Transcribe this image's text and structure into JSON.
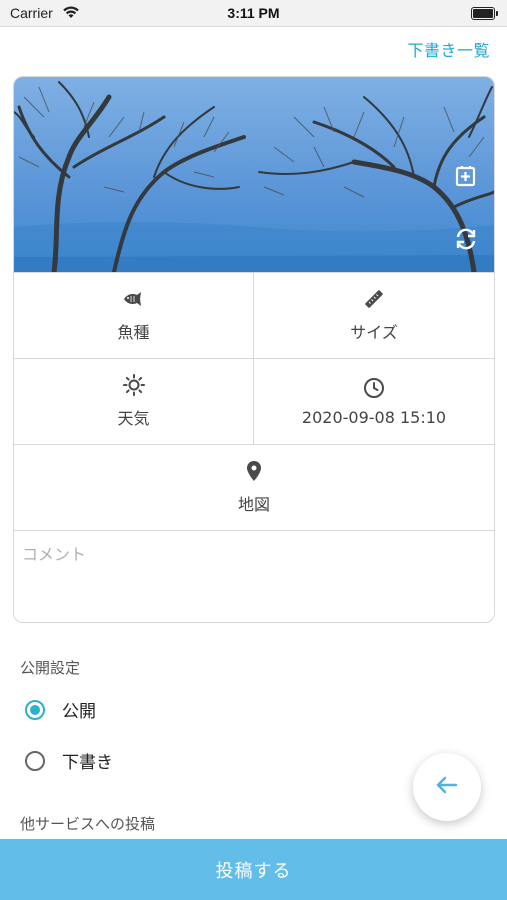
{
  "status_bar": {
    "carrier": "Carrier",
    "time": "3:11 PM"
  },
  "header": {
    "drafts_link": "下書き一覧"
  },
  "photo": {
    "icons": [
      "add-photo-icon",
      "rotate-icon"
    ]
  },
  "fields": {
    "fish": {
      "label": "魚種",
      "icon": "fish-icon"
    },
    "size": {
      "label": "サイズ",
      "icon": "ruler-icon"
    },
    "weather": {
      "label": "天気",
      "icon": "sun-icon"
    },
    "datetime": {
      "label": "2020-09-08 15:10",
      "icon": "clock-icon"
    },
    "map": {
      "label": "地図",
      "icon": "map-pin-icon"
    }
  },
  "comment": {
    "placeholder": "コメント",
    "value": ""
  },
  "visibility": {
    "title": "公開設定",
    "options": [
      {
        "label": "公開",
        "selected": true
      },
      {
        "label": "下書き",
        "selected": false
      }
    ]
  },
  "other_services": {
    "title": "他サービスへの投稿"
  },
  "actions": {
    "back_icon": "arrow-left-icon",
    "submit_label": "投稿する"
  },
  "colors": {
    "accent": "#23a7d4",
    "radio": "#2bb0ce",
    "submit_bg": "#62bde8"
  }
}
